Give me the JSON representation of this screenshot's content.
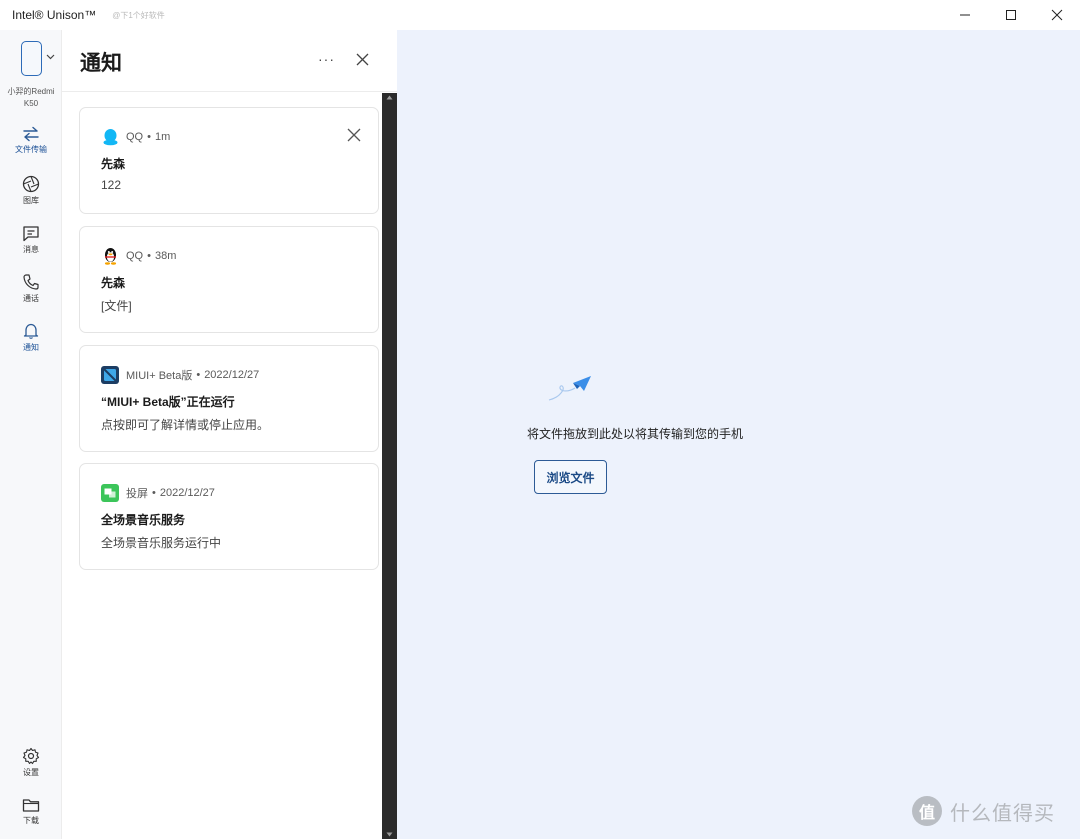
{
  "window": {
    "title": "Intel® Unison™",
    "watermark": "@下1个好软件",
    "controls": [
      "minimize-icon",
      "maximize-icon",
      "close-icon"
    ]
  },
  "rail": {
    "device_name": "小羿的Redmi K50",
    "items": [
      {
        "label": "文件传输",
        "icon": "transfer-arrows-icon",
        "active": true
      },
      {
        "label": "图库",
        "icon": "aperture-icon",
        "active": false
      },
      {
        "label": "消息",
        "icon": "chat-bubble-icon",
        "active": false
      },
      {
        "label": "通话",
        "icon": "phone-icon",
        "active": false
      },
      {
        "label": "通知",
        "icon": "bell-icon",
        "active": false
      }
    ],
    "bottom_items": [
      {
        "label": "设置",
        "icon": "gear-icon"
      },
      {
        "label": "下载",
        "icon": "folder-icon"
      }
    ]
  },
  "panel": {
    "title": "通知",
    "more_label": "···"
  },
  "notifications": [
    {
      "app": "QQ",
      "sep": "•",
      "time": "1m",
      "title": "先森",
      "body": "122",
      "icon": "qq-penguin-icon",
      "dismissable": true
    },
    {
      "app": "QQ",
      "sep": "•",
      "time": "38m",
      "title": "先森",
      "body": "[文件]",
      "icon": "qq-penguin-icon",
      "dismissable": false
    },
    {
      "app": "MIUI+ Beta版",
      "sep": "•",
      "time": "2022/12/27",
      "title": "“MIUI+ Beta版”正在运行",
      "body": "点按即可了解详情或停止应用。",
      "icon": "miui-plus-icon",
      "dismissable": false
    },
    {
      "app": "投屏",
      "sep": "•",
      "time": "2022/12/27",
      "title": "全场景音乐服务",
      "body": "全场景音乐服务运行中",
      "icon": "screen-cast-icon",
      "dismissable": false
    }
  ],
  "dropzone": {
    "instruction": "将文件拖放到此处以将其传输到您的手机",
    "browse_label": "浏览文件"
  },
  "watermark_logo": {
    "badge": "值",
    "text": "什么值得买"
  },
  "colors": {
    "accent": "#2d6bb8",
    "dropzone_bg": "#edf2fc",
    "scrollbar": "#2b2b2b"
  }
}
